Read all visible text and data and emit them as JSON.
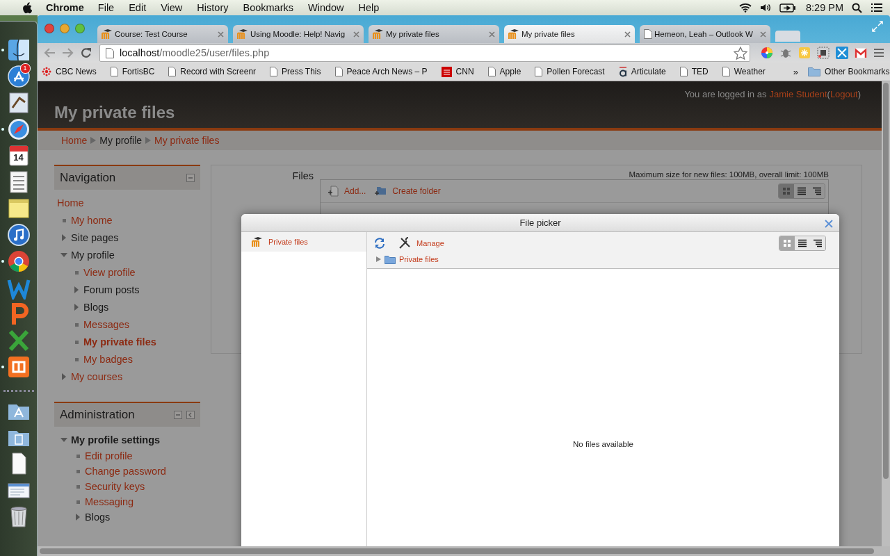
{
  "menubar": {
    "app": "Chrome",
    "menus": [
      "File",
      "Edit",
      "View",
      "History",
      "Bookmarks",
      "Window",
      "Help"
    ],
    "clock": "8:29 PM"
  },
  "dock": {
    "apps": [
      {
        "kind": "finder",
        "running": true
      },
      {
        "kind": "appstore",
        "running": false,
        "badge": "1"
      },
      {
        "kind": "mail",
        "running": false
      },
      {
        "kind": "safari",
        "running": true
      },
      {
        "kind": "calendar",
        "running": false,
        "label": "14"
      },
      {
        "kind": "reminders",
        "running": false
      },
      {
        "kind": "stickies",
        "running": false
      },
      {
        "kind": "itunes",
        "running": false
      },
      {
        "kind": "chrome",
        "running": true
      },
      {
        "kind": "word",
        "running": false
      },
      {
        "kind": "powerpoint",
        "running": false
      },
      {
        "kind": "excel",
        "running": false
      },
      {
        "kind": "xampp",
        "running": true
      }
    ],
    "stacks": [
      {
        "kind": "applications"
      },
      {
        "kind": "documents"
      },
      {
        "kind": "file"
      },
      {
        "kind": "screenshot"
      },
      {
        "kind": "trash"
      }
    ]
  },
  "tabs": [
    {
      "label": "Course: Test Course",
      "kind": "moodle",
      "selected": false
    },
    {
      "label": "Using Moodle: Help! Navig",
      "kind": "moodle",
      "selected": false
    },
    {
      "label": "My private files",
      "kind": "moodle",
      "selected": false
    },
    {
      "label": "My private files",
      "kind": "moodle",
      "selected": true
    },
    {
      "label": "Hemeon, Leah – Outlook W",
      "kind": "page",
      "selected": false
    }
  ],
  "address": {
    "host": "localhost",
    "path": "/moodle25/user/files.php"
  },
  "bookmarks": {
    "items": [
      {
        "label": "CBC News",
        "kind": "dots"
      },
      {
        "label": "FortisBC",
        "kind": "page"
      },
      {
        "label": "Record with Screenr",
        "kind": "page"
      },
      {
        "label": "Press This",
        "kind": "page"
      },
      {
        "label": "Peace Arch News – P",
        "kind": "page"
      },
      {
        "label": "CNN",
        "kind": "square"
      },
      {
        "label": "Apple",
        "kind": "page"
      },
      {
        "label": "Pollen Forecast",
        "kind": "page"
      },
      {
        "label": "Articulate",
        "kind": "letter"
      },
      {
        "label": "TED",
        "kind": "page"
      },
      {
        "label": "Weather",
        "kind": "page"
      }
    ],
    "overflow": "»",
    "other": "Other Bookmarks"
  },
  "page": {
    "title": "My private files",
    "login": [
      {
        "text": "You are logged in as",
        "link": false
      },
      {
        "text": "Jamie Student",
        "link": true
      },
      {
        "text": "(",
        "link": false
      },
      {
        "text": "Logout",
        "link": true
      },
      {
        "text": ")",
        "link": false
      }
    ],
    "breadcrumb": [
      {
        "label": "Home",
        "link": true
      },
      {
        "label": "My profile",
        "link": false
      },
      {
        "label": "My private files",
        "link": true
      }
    ],
    "blocks": [
      {
        "title": "Navigation",
        "controls": [
          {
            "kind": "collapse"
          }
        ],
        "items": [
          {
            "label": "Home",
            "kind": "root",
            "link": true,
            "bold": false
          },
          {
            "label": "My home",
            "kind": "leaf",
            "link": true,
            "bold": false
          },
          {
            "label": "Site pages",
            "kind": "branch",
            "link": false,
            "bold": false,
            "expanded": false
          },
          {
            "label": "My profile",
            "kind": "branch",
            "link": false,
            "bold": false,
            "expanded": true,
            "children": [
              {
                "label": "View profile",
                "kind": "leaf",
                "link": true,
                "bold": false
              },
              {
                "label": "Forum posts",
                "kind": "branch",
                "link": false,
                "bold": false,
                "expanded": false
              },
              {
                "label": "Blogs",
                "kind": "branch",
                "link": false,
                "bold": false,
                "expanded": false
              },
              {
                "label": "Messages",
                "kind": "leaf",
                "link": true,
                "bold": false
              },
              {
                "label": "My private files",
                "kind": "leaf",
                "link": true,
                "bold": true
              },
              {
                "label": "My badges",
                "kind": "leaf",
                "link": true,
                "bold": false
              }
            ]
          },
          {
            "label": "My courses",
            "kind": "branch",
            "link": true,
            "bold": false,
            "expanded": false
          }
        ]
      },
      {
        "title": "Administration",
        "controls": [
          {
            "kind": "collapse"
          },
          {
            "kind": "dock"
          }
        ],
        "items": [
          {
            "label": "My profile settings",
            "kind": "branch",
            "link": false,
            "bold": true,
            "expanded": true,
            "children": [
              {
                "label": "Edit profile",
                "kind": "leaf",
                "link": true,
                "bold": false
              },
              {
                "label": "Change password",
                "kind": "leaf",
                "link": true,
                "bold": false
              },
              {
                "label": "Security keys",
                "kind": "leaf",
                "link": true,
                "bold": false
              },
              {
                "label": "Messaging",
                "kind": "leaf",
                "link": true,
                "bold": false
              },
              {
                "label": "Blogs",
                "kind": "branch",
                "link": false,
                "bold": false,
                "expanded": false
              }
            ]
          }
        ]
      }
    ],
    "files": {
      "label": "Files",
      "limit": "Maximum size for new files: 100MB, overall limit: 100MB",
      "actions": [
        {
          "label": "Add...",
          "kind": "add"
        },
        {
          "label": "Create folder",
          "kind": "folder"
        }
      ],
      "views": [
        {
          "kind": "icons",
          "selected": true
        },
        {
          "kind": "list",
          "selected": false
        },
        {
          "kind": "tree",
          "selected": false
        }
      ]
    }
  },
  "picker": {
    "title": "File picker",
    "repositories": [
      {
        "label": "Private files",
        "selected": true
      }
    ],
    "manage": "Manage",
    "views": [
      {
        "kind": "icons",
        "selected": true
      },
      {
        "kind": "list",
        "selected": false
      },
      {
        "kind": "tree",
        "selected": false
      }
    ],
    "path": "Private files",
    "empty": "No files available"
  }
}
